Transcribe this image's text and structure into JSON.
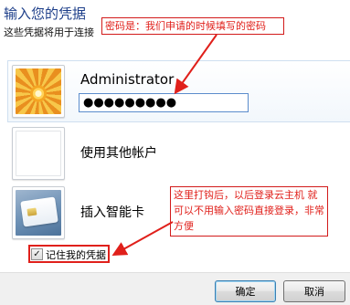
{
  "dialog": {
    "title": "输入您的凭据",
    "subtitle": "这些凭据将用于连接"
  },
  "accounts": {
    "selected": {
      "username": "Administrator",
      "password_masked": "●●●●●●●●●",
      "avatar_icon": "flower-avatar-icon"
    },
    "other_user_label": "使用其他帐户",
    "smart_card_label": "插入智能卡"
  },
  "remember": {
    "label": "记住我的凭据",
    "checked": true
  },
  "buttons": {
    "ok": "确定",
    "cancel": "取消"
  },
  "annotations": {
    "password_note": "密码是：我们申请的时候填写的密码",
    "remember_note": "这里打钩后，以后登录云主机 就可以不用输入密码直接登录，非常方便",
    "color": "#e0201b"
  }
}
